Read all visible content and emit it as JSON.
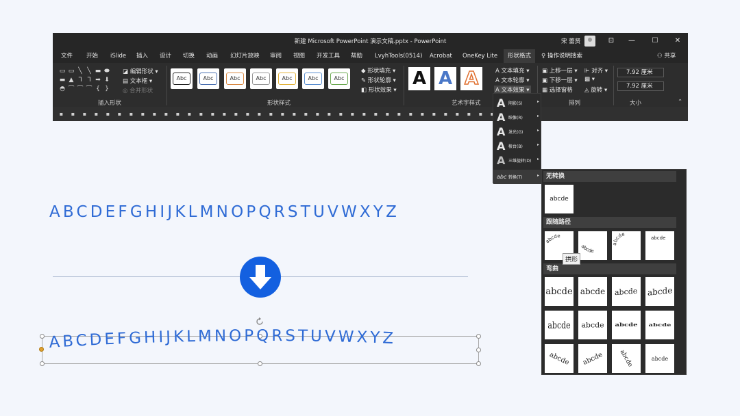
{
  "window": {
    "title": "新建 Microsoft PowerPoint 演示文稿.pptx  -  PowerPoint",
    "user": "宋 蕾贤",
    "controls": {
      "ribbon_display": "⊡",
      "minimize": "—",
      "maximize": "☐",
      "close": "✕"
    }
  },
  "tabs": [
    "文件",
    "开始",
    "iSlide",
    "插入",
    "设计",
    "切换",
    "动画",
    "幻灯片放映",
    "审阅",
    "视图",
    "开发工具",
    "帮助",
    "LvyhTools(0514)",
    "Acrobat",
    "OneKey Lite",
    "形状格式"
  ],
  "active_tab": "形状格式",
  "help_search": "操作说明搜索",
  "share": "共享",
  "ribbon": {
    "insert_shapes": {
      "label": "插入形状",
      "edit_shape": "编辑形状 ▾",
      "text_box": "文本框 ▾",
      "merge_shapes": "合并形状",
      "shape_glyphs": [
        "▭",
        "▭",
        "╲",
        "╲",
        "▬",
        "⬬",
        "▬",
        "▲",
        "ᒣ",
        "ᒣ",
        "➡",
        "⬇",
        "◓",
        "⌒",
        "⌒",
        "⌒",
        "{",
        "}"
      ]
    },
    "shape_styles": {
      "label": "形状样式",
      "sample": "Abc",
      "styles": [
        "#222222",
        "#4a6fb0",
        "#d98a45",
        "#999999",
        "#e2b33c",
        "#5b8fd0",
        "#6aa84f"
      ],
      "fill": "形状填充 ▾",
      "outline": "形状轮廓 ▾",
      "effects": "形状效果 ▾"
    },
    "wordart_styles": {
      "label": "艺术字样式",
      "glyph": "A",
      "colors": [
        "#111111",
        "#4a78c8",
        "#e07030"
      ],
      "text_fill": "文本填充 ▾",
      "text_outline": "文本轮廓 ▾",
      "text_effects": "文本效果 ▾"
    },
    "arrange": {
      "label": "排列",
      "bring_forward": "上移一层 ▾",
      "send_backward": "下移一层 ▾",
      "selection_pane": "选择窗格",
      "align": "对齐 ▾",
      "group": "▾",
      "rotate": "旋转 ▾"
    },
    "size": {
      "label": "大小",
      "height": "7.92 厘米",
      "width": "7.92 厘米"
    }
  },
  "text_effects_menu": [
    {
      "glyph": "A",
      "label": "阴影(S)"
    },
    {
      "glyph": "A",
      "label": "映像(R)"
    },
    {
      "glyph": "A",
      "label": "发光(G)"
    },
    {
      "glyph": "A",
      "label": "棱台(B)"
    },
    {
      "glyph": "A",
      "label": "三维旋转(D)"
    },
    {
      "glyph": "abc",
      "label": "转换(T)"
    }
  ],
  "transform_gallery": {
    "no_transform": "无转换",
    "no_transform_sample": "abcde",
    "follow_path": "跟随路径",
    "warp": "弯曲",
    "sample": "abcde",
    "tooltip": "拱形"
  },
  "slide": {
    "alphabet": "ABCDEFGHIJKLMNOPQRSTUVWXYZ",
    "accent_color": "#1360e0",
    "text_color": "#2f6bd5"
  }
}
